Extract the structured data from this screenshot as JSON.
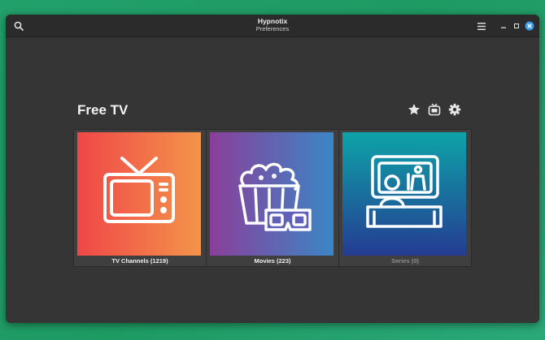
{
  "window": {
    "title": "Hypnotix",
    "subtitle": "Preferences"
  },
  "header": {
    "search_icon": "search-icon",
    "menu_icon": "hamburger-menu-icon",
    "minimize_icon": "minimize-icon",
    "maximize_icon": "maximize-icon",
    "close_icon": "close-icon",
    "close_color": "#3d9be9"
  },
  "provider": {
    "name": "Free TV",
    "actions": [
      {
        "icon": "star-icon"
      },
      {
        "icon": "tv-icon"
      },
      {
        "icon": "gear-icon"
      }
    ]
  },
  "categories": [
    {
      "label": "TV Channels (1219)",
      "icon": "television-icon",
      "gradient": [
        "#ef4748",
        "#f4944a"
      ],
      "enabled": true
    },
    {
      "label": "Movies (223)",
      "icon": "popcorn-3d-glasses-icon",
      "gradient": [
        "#8a3f9a",
        "#3b86c6"
      ],
      "enabled": true
    },
    {
      "label": "Series (0)",
      "icon": "couch-viewer-icon",
      "gradient": [
        "#0ea3a8",
        "#243c92"
      ],
      "enabled": false
    }
  ]
}
